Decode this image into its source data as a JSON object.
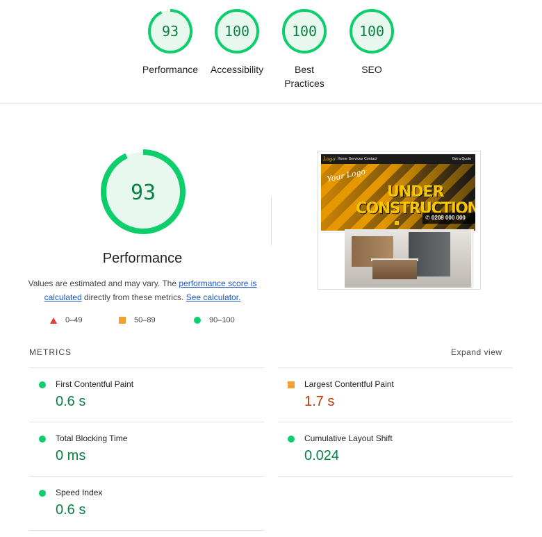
{
  "top_gauges": [
    {
      "score": "93",
      "label": "Performance"
    },
    {
      "score": "100",
      "label": "Accessibility"
    },
    {
      "score": "100",
      "label": "Best Practices"
    },
    {
      "score": "100",
      "label": "SEO"
    }
  ],
  "main": {
    "score": "93",
    "fraction": 0.93,
    "title": "Performance",
    "desc_part1": "Values are estimated and may vary. The ",
    "desc_link1": "performance score is calculated",
    "desc_part2": " directly from these metrics. ",
    "desc_link2": "See calculator."
  },
  "legend": [
    {
      "icon": "triangle-icon",
      "range": "0–49",
      "color": "#e53935"
    },
    {
      "icon": "square-icon",
      "range": "50–89",
      "color": "#f4a030"
    },
    {
      "icon": "circle-icon",
      "range": "90–100",
      "color": "#0cce6b"
    }
  ],
  "screenshot": {
    "nav_logo": "Logo",
    "nav_links": "Home  Services  Contact",
    "nav_cta": "Get a Quote",
    "hero_logo": "Your Logo",
    "hero_line1": "UNDER",
    "hero_line2": "CONSTRUCTION",
    "hero_phone": "✆ 0208 000 000"
  },
  "metrics": {
    "title": "METRICS",
    "expand": "Expand view",
    "items": [
      {
        "label": "First Contentful Paint",
        "value": "0.6 s",
        "status": "good"
      },
      {
        "label": "Largest Contentful Paint",
        "value": "1.7 s",
        "status": "average"
      },
      {
        "label": "Total Blocking Time",
        "value": "0 ms",
        "status": "good"
      },
      {
        "label": "Cumulative Layout Shift",
        "value": "0.024",
        "status": "good"
      },
      {
        "label": "Speed Index",
        "value": "0.6 s",
        "status": "good"
      }
    ]
  },
  "colors": {
    "pass": "#0cce6b",
    "pass_text": "#0b8043",
    "average": "#f4a030",
    "average_text": "#c33300",
    "fail": "#e53935",
    "link": "#1a56c2"
  }
}
